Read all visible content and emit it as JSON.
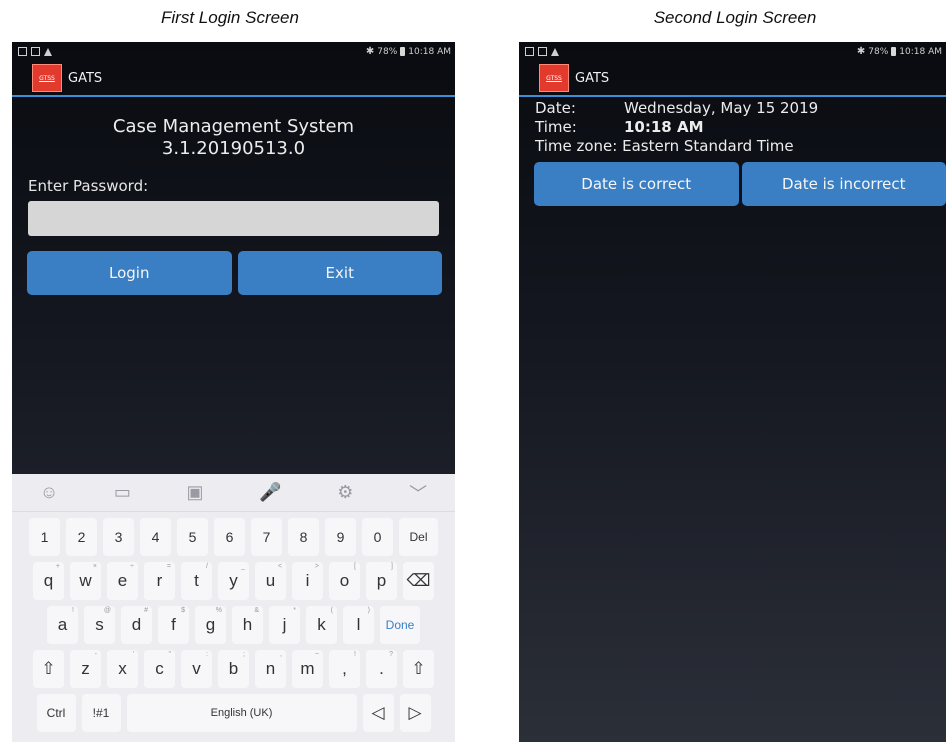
{
  "captions": {
    "first": "First Login Screen",
    "second": "Second Login Screen"
  },
  "status": {
    "battery": "78%",
    "time": "10:18 AM"
  },
  "app": {
    "logo_text": "GTSS",
    "name": "GATS"
  },
  "login": {
    "system_title": "Case Management System",
    "version": "3.1.20190513.0",
    "password_label": "Enter Password:",
    "password_value": "",
    "login_button": "Login",
    "exit_button": "Exit"
  },
  "keyboard": {
    "toolbar": [
      "☺",
      "▭",
      "▣",
      "🎤",
      "⚙",
      "﹀"
    ],
    "row_numbers": [
      "1",
      "2",
      "3",
      "4",
      "5",
      "6",
      "7",
      "8",
      "9",
      "0",
      "Del"
    ],
    "row1": [
      {
        "k": "q",
        "s": "+"
      },
      {
        "k": "w",
        "s": "×"
      },
      {
        "k": "e",
        "s": "÷"
      },
      {
        "k": "r",
        "s": "="
      },
      {
        "k": "t",
        "s": "/"
      },
      {
        "k": "y",
        "s": "_"
      },
      {
        "k": "u",
        "s": "<"
      },
      {
        "k": "i",
        "s": ">"
      },
      {
        "k": "o",
        "s": "["
      },
      {
        "k": "p",
        "s": "]"
      },
      {
        "k": "⌫",
        "s": ""
      }
    ],
    "row2": [
      {
        "k": "a",
        "s": "!"
      },
      {
        "k": "s",
        "s": "@"
      },
      {
        "k": "d",
        "s": "#"
      },
      {
        "k": "f",
        "s": "$"
      },
      {
        "k": "g",
        "s": "%"
      },
      {
        "k": "h",
        "s": "&"
      },
      {
        "k": "j",
        "s": "*"
      },
      {
        "k": "k",
        "s": "("
      },
      {
        "k": "l",
        "s": ")"
      },
      {
        "k": "Done",
        "s": ""
      }
    ],
    "row3": [
      {
        "k": "⇧",
        "s": ""
      },
      {
        "k": "z",
        "s": "-"
      },
      {
        "k": "x",
        "s": "'"
      },
      {
        "k": "c",
        "s": "\""
      },
      {
        "k": "v",
        "s": ":"
      },
      {
        "k": "b",
        "s": ";"
      },
      {
        "k": "n",
        "s": ","
      },
      {
        "k": "m",
        "s": "~"
      },
      {
        "k": ",",
        "s": "!"
      },
      {
        "k": ".",
        "s": "?"
      },
      {
        "k": "⇧",
        "s": ""
      }
    ],
    "bottom": {
      "ctrl": "Ctrl",
      "sym": "!#1",
      "space": "English (UK)",
      "left": "◁",
      "right": "▷"
    }
  },
  "date_screen": {
    "date_label": "Date:",
    "date_value": "Wednesday, May 15 2019",
    "time_label": "Time:",
    "time_value": "10:18 AM",
    "tz_label": "Time zone:",
    "tz_value": "Eastern Standard Time",
    "correct_button": "Date is correct",
    "incorrect_button": "Date is incorrect"
  },
  "colors": {
    "accent": "#3a7fc4",
    "logo": "#e23b2e",
    "divider": "#3b8fd8"
  }
}
